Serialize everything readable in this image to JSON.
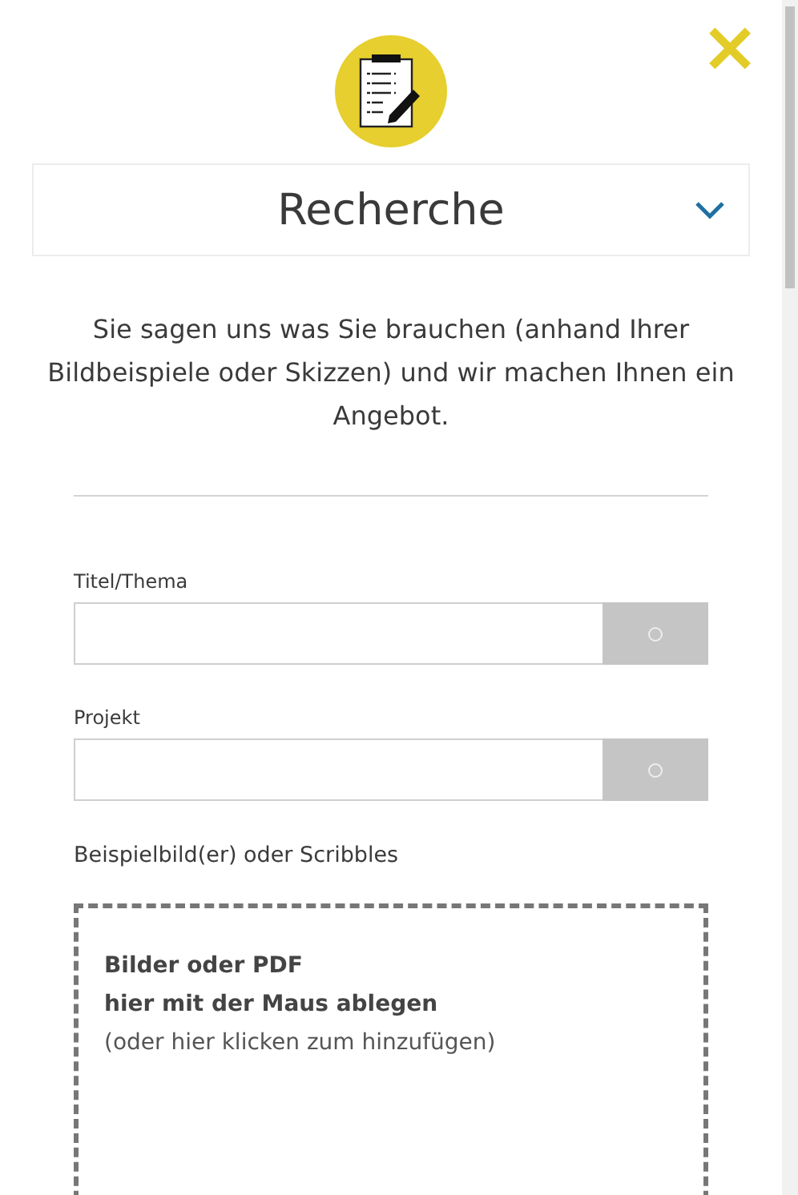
{
  "close_button": "×",
  "category_select": {
    "value": "Recherche",
    "expanded": false
  },
  "description": "Sie sagen uns was Sie brauchen (anhand Ihrer Bildbeispiele oder Skizzen) und wir machen Ihnen ein Angebot.",
  "fields": [
    {
      "label": "Titel/Thema"
    },
    {
      "label": "Projekt"
    }
  ],
  "upload": {
    "label": "Beispielbild(er) oder Scribbles",
    "lines": [
      {
        "text": "Bilder oder PDF",
        "bold": true
      },
      {
        "text": "hier mit der Maus ablegen",
        "bold": true
      },
      {
        "text": "(oder hier klicken zum hinzufügen)",
        "bold": false
      }
    ]
  }
}
